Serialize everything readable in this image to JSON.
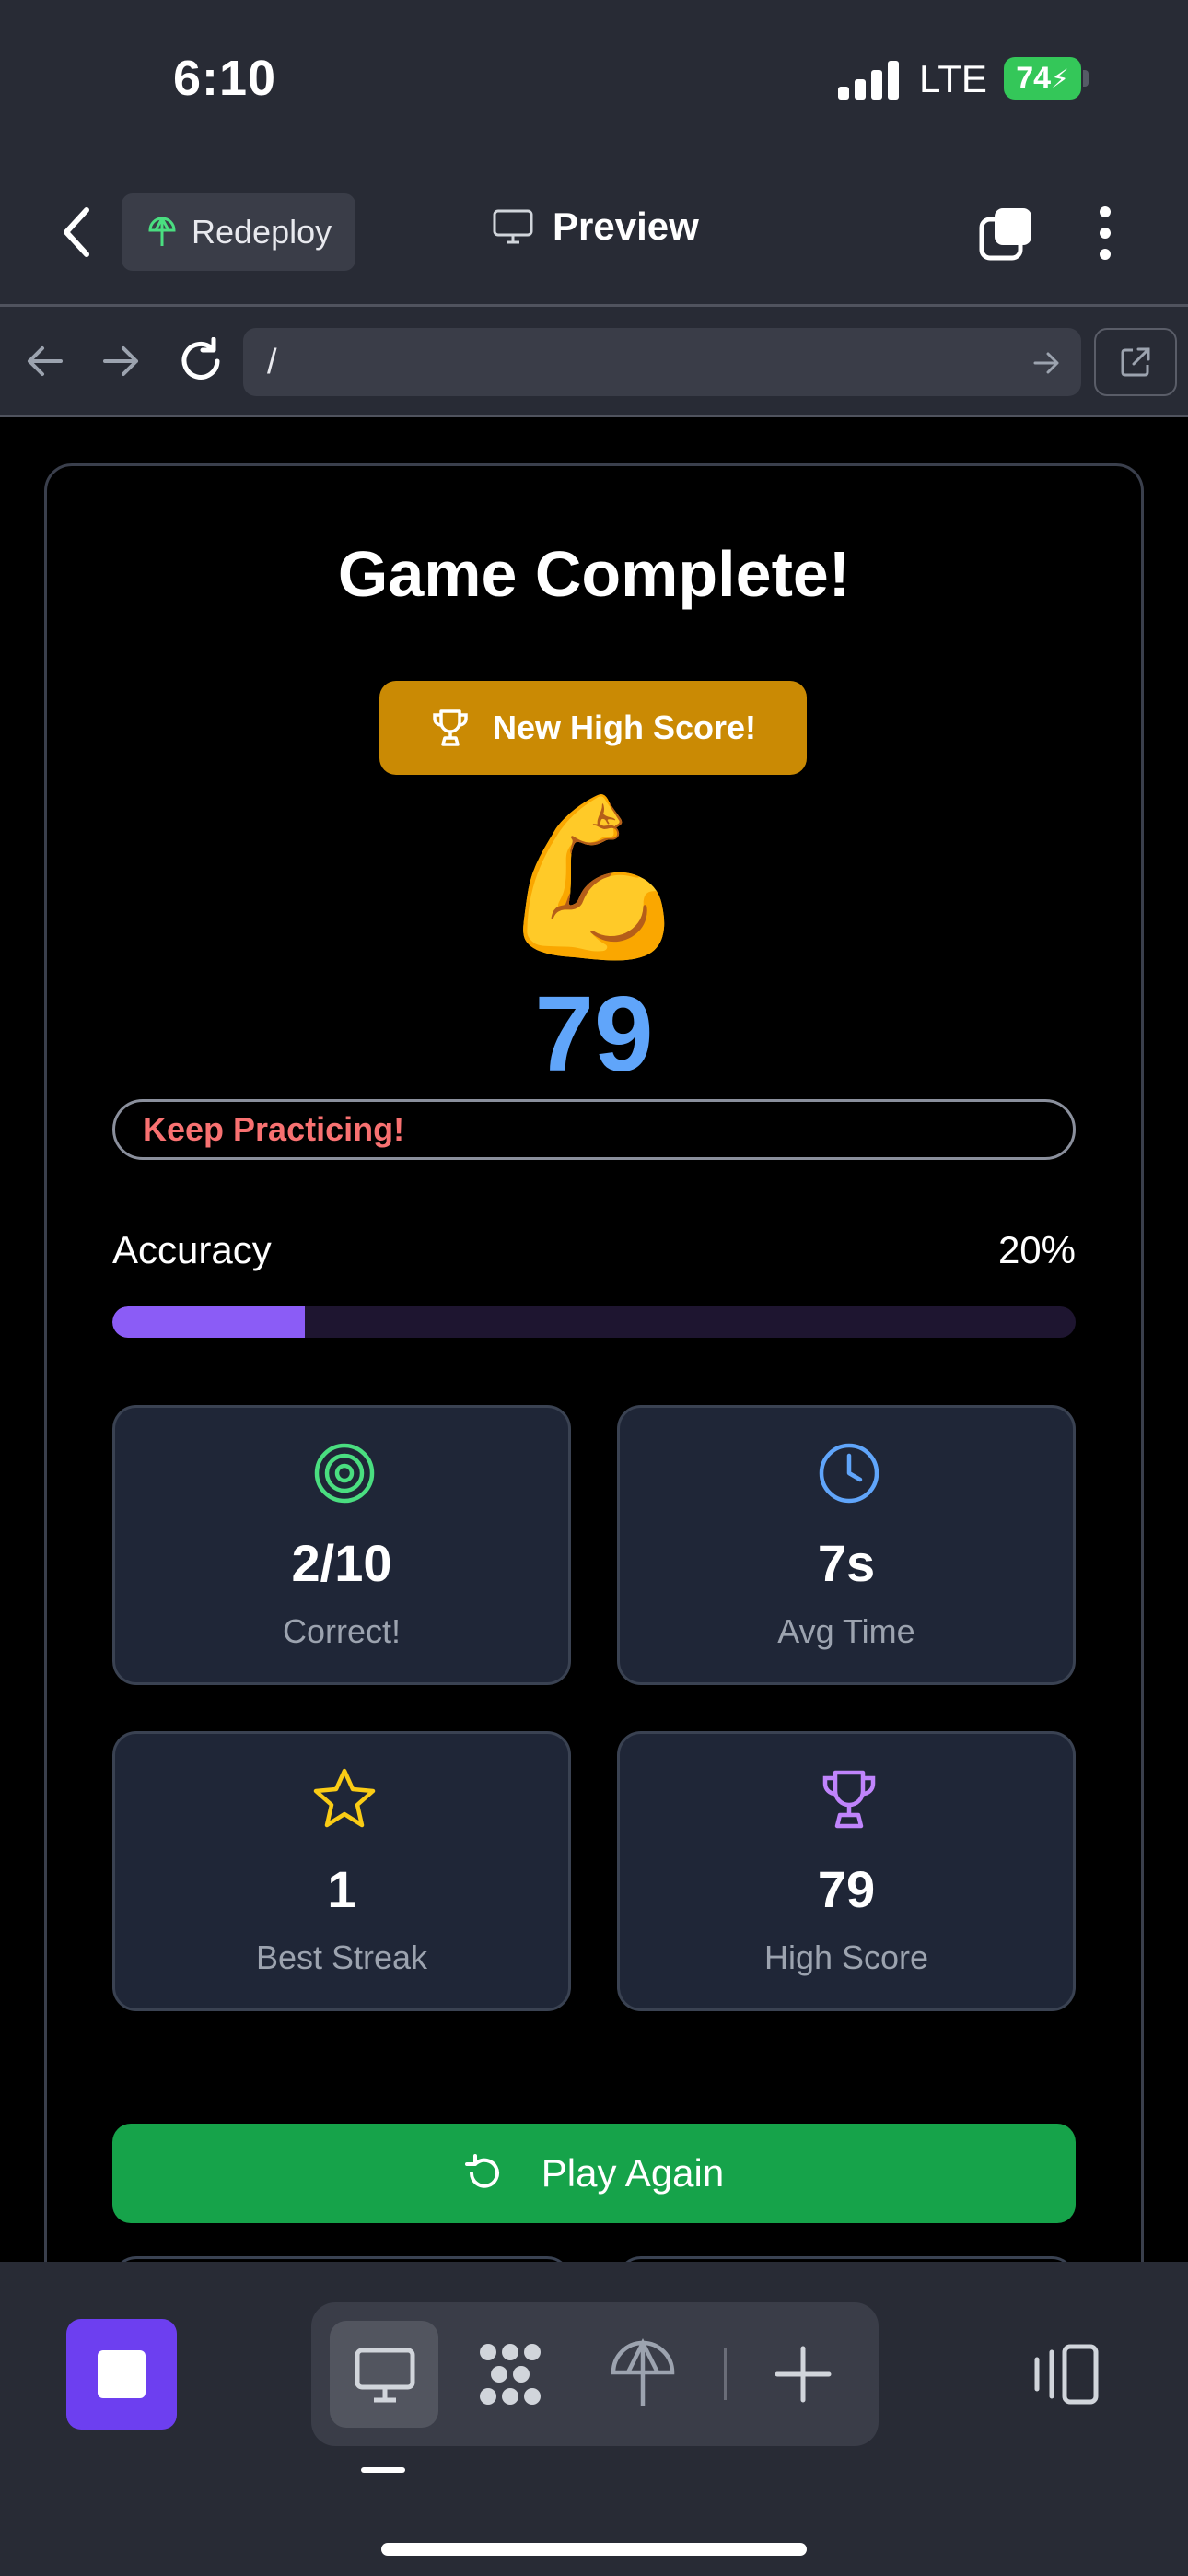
{
  "status_bar": {
    "time": "6:10",
    "network": "LTE",
    "battery": "74"
  },
  "header": {
    "redeploy_label": "Redeploy",
    "preview_label": "Preview"
  },
  "url_bar": {
    "url": "/"
  },
  "game": {
    "title": "Game Complete!",
    "high_score_badge": "New High Score!",
    "emoji": "💪",
    "score": "79",
    "message": "Keep Practicing!",
    "accuracy_label": "Accuracy",
    "accuracy_value": "20%",
    "accuracy_fraction": 0.2,
    "stats": [
      {
        "value": "2/10",
        "label": "Correct!",
        "icon": "target-icon",
        "color": "#4ade80"
      },
      {
        "value": "7s",
        "label": "Avg Time",
        "icon": "clock-icon",
        "color": "#60a5fa"
      },
      {
        "value": "1",
        "label": "Best Streak",
        "icon": "star-icon",
        "color": "#facc15"
      },
      {
        "value": "79",
        "label": "High Score",
        "icon": "trophy-icon",
        "color": "#c084fc"
      }
    ],
    "play_again_label": "Play Again"
  },
  "colors": {
    "accent": "#6d3ff0",
    "play_again": "#16a34a",
    "badge": "#ca8a04",
    "score": "#60a5fa",
    "progress": "#8b5cf6"
  }
}
